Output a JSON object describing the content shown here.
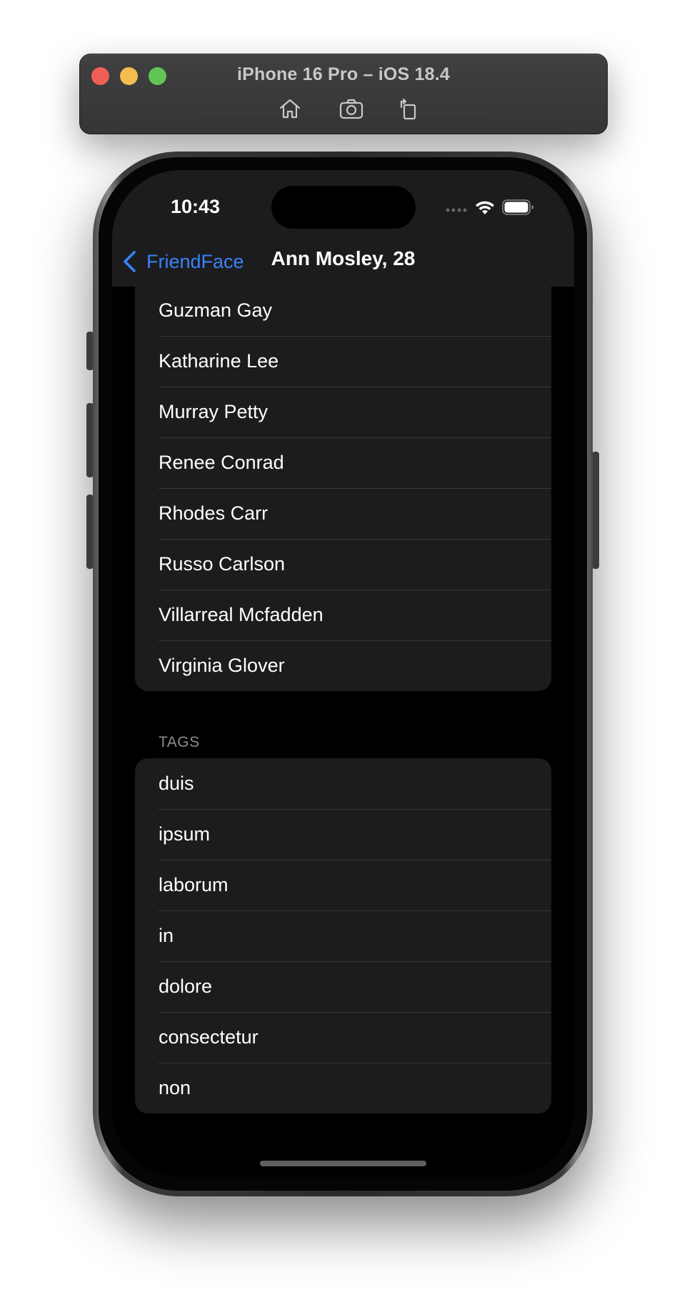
{
  "simulator": {
    "title": "iPhone 16 Pro – iOS 18.4",
    "toolbar": [
      "home-icon",
      "screenshot-icon",
      "rotate-icon"
    ],
    "traffic_lights": {
      "close": "#ee5f57",
      "minimize": "#f4bd4f",
      "zoom": "#61c554"
    }
  },
  "status_bar": {
    "time": "10:43"
  },
  "nav": {
    "back_label": "FriendFace",
    "title": "Ann Mosley, 28",
    "accent": "#3a82f7"
  },
  "friends": [
    "Guzman Gay",
    "Katharine Lee",
    "Murray Petty",
    "Renee Conrad",
    "Rhodes Carr",
    "Russo Carlson",
    "Villarreal Mcfadden",
    "Virginia Glover"
  ],
  "tags_section": {
    "header": "TAGS",
    "items": [
      "duis",
      "ipsum",
      "laborum",
      "in",
      "dolore",
      "consectetur",
      "non"
    ]
  }
}
